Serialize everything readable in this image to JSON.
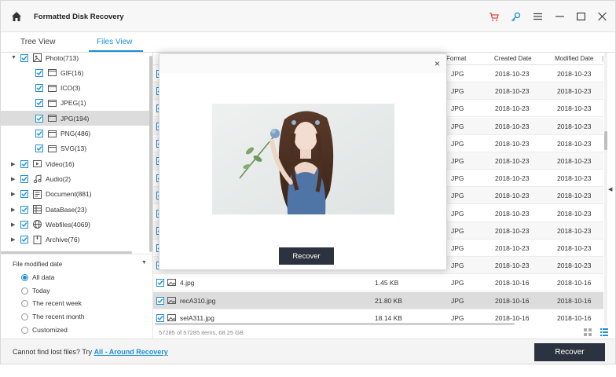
{
  "app": {
    "title": "Formatted Disk Recovery"
  },
  "titlebar_icons": [
    "home-icon",
    "cart-icon",
    "key-icon",
    "menu-icon",
    "minimize-icon",
    "maximize-icon",
    "close-icon"
  ],
  "tabs": [
    {
      "label": "Tree View",
      "active": false
    },
    {
      "label": "Files View",
      "active": true
    }
  ],
  "search": {
    "placeholder": ""
  },
  "tree": [
    {
      "label": "Photo(713)",
      "level": 0,
      "expanded": true
    },
    {
      "label": "GIF(16)",
      "level": 1
    },
    {
      "label": "ICO(3)",
      "level": 1
    },
    {
      "label": "JPEG(1)",
      "level": 1
    },
    {
      "label": "JPG(194)",
      "level": 1,
      "selected": true
    },
    {
      "label": "PNG(486)",
      "level": 1
    },
    {
      "label": "SVG(13)",
      "level": 1
    },
    {
      "label": "Video(16)",
      "level": 0
    },
    {
      "label": "Audio(2)",
      "level": 0
    },
    {
      "label": "Document(881)",
      "level": 0
    },
    {
      "label": "DataBase(23)",
      "level": 0
    },
    {
      "label": "Webfiles(4069)",
      "level": 0
    },
    {
      "label": "Archive(76)",
      "level": 0
    }
  ],
  "filter": {
    "title": "File modified date",
    "options": [
      "All data",
      "Today",
      "The recent week",
      "The recent month",
      "Customized"
    ],
    "selected": "All data"
  },
  "table": {
    "headers": {
      "format": "Format",
      "created": "Created Date",
      "modified": "Modified Date"
    },
    "rows": [
      {
        "name": "",
        "size": "",
        "format": "JPG",
        "created": "2018-10-23",
        "modified": "2018-10-23"
      },
      {
        "name": "",
        "size": "",
        "format": "JPG",
        "created": "2018-10-23",
        "modified": "2018-10-23"
      },
      {
        "name": "",
        "size": "",
        "format": "JPG",
        "created": "2018-10-23",
        "modified": "2018-10-23"
      },
      {
        "name": "",
        "size": "",
        "format": "JPG",
        "created": "2018-10-23",
        "modified": "2018-10-23"
      },
      {
        "name": "",
        "size": "",
        "format": "JPG",
        "created": "2018-10-23",
        "modified": "2018-10-23"
      },
      {
        "name": "",
        "size": "",
        "format": "JPG",
        "created": "2018-10-23",
        "modified": "2018-10-23"
      },
      {
        "name": "",
        "size": "",
        "format": "JPG",
        "created": "2018-10-23",
        "modified": "2018-10-23"
      },
      {
        "name": "",
        "size": "",
        "format": "JPG",
        "created": "2018-10-23",
        "modified": "2018-10-23"
      },
      {
        "name": "",
        "size": "",
        "format": "JPG",
        "created": "2018-10-23",
        "modified": "2018-10-23"
      },
      {
        "name": "",
        "size": "",
        "format": "JPG",
        "created": "2018-10-23",
        "modified": "2018-10-23"
      },
      {
        "name": "",
        "size": "",
        "format": "JPG",
        "created": "2018-10-23",
        "modified": "2018-10-23"
      },
      {
        "name": "",
        "size": "",
        "format": "JPG",
        "created": "2018-10-23",
        "modified": "2018-10-23"
      },
      {
        "name": "4.jpg",
        "size": "1.45 KB",
        "format": "JPG",
        "created": "2018-10-16",
        "modified": "2018-10-16"
      },
      {
        "name": "recA310.jpg",
        "size": "21.80 KB",
        "format": "JPG",
        "created": "2018-10-16",
        "modified": "2018-10-16",
        "selected": true
      },
      {
        "name": "selA311.jpg",
        "size": "18.14 KB",
        "format": "JPG",
        "created": "2018-10-16",
        "modified": "2018-10-16"
      }
    ]
  },
  "status": {
    "text": "57285 of 57285 items, 68.25 GB"
  },
  "footer": {
    "prompt": "Cannot find lost files? Try ",
    "link": "All - Around Recovery",
    "recover_label": "Recover"
  },
  "modal": {
    "recover_label": "Recover",
    "close_glyph": "×"
  },
  "colors": {
    "accent": "#1e8fd6",
    "dark_button": "#2b3340",
    "cart": "#e8453c"
  }
}
